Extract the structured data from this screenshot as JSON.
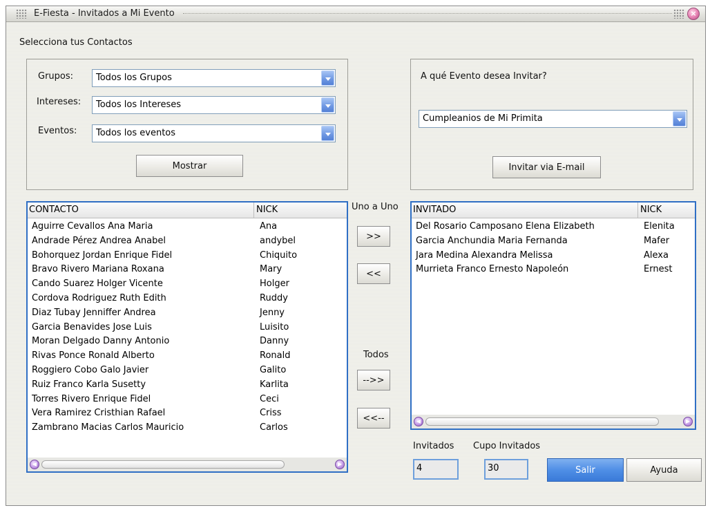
{
  "window": {
    "title": "E-Fiesta  - Invitados a Mi Evento",
    "close_glyph": "×"
  },
  "section_title": "Selecciona tus Contactos",
  "filters": {
    "grupos_label": "Grupos:",
    "grupos_value": "Todos los Grupos",
    "intereses_label": "Intereses:",
    "intereses_value": "Todos los Intereses",
    "eventos_label": "Eventos:",
    "eventos_value": "Todos los eventos",
    "mostrar_label": "Mostrar"
  },
  "event": {
    "question": "A qué Evento desea Invitar?",
    "selected_event": "Cumpleanios de Mi Primita",
    "invite_button": "Invitar via E-mail"
  },
  "contacts": {
    "columns": [
      "CONTACTO",
      "NICK"
    ],
    "rows": [
      [
        "Aguirre Cevallos Ana Maria",
        "Ana"
      ],
      [
        "Andrade Pérez Andrea Anabel",
        "andybel"
      ],
      [
        "Bohorquez Jordan Enrique Fidel",
        "Chiquito"
      ],
      [
        "Bravo Rivero Mariana Roxana",
        "Mary"
      ],
      [
        "Cando Suarez Holger Vicente",
        "Holger"
      ],
      [
        "Cordova Rodriguez Ruth Edith",
        "Ruddy"
      ],
      [
        "Diaz Tubay Jenniffer Andrea",
        "Jenny"
      ],
      [
        "Garcia Benavides Jose Luis",
        "Luisito"
      ],
      [
        "Moran Delgado Danny Antonio",
        "Danny"
      ],
      [
        "Rivas Ponce Ronald Alberto",
        "Ronald"
      ],
      [
        "Roggiero Cobo Galo Javier",
        "Galito"
      ],
      [
        "Ruiz Franco Karla Susetty",
        "Karlita"
      ],
      [
        "Torres Rivero Enrique Fidel",
        "Ceci"
      ],
      [
        "Vera Ramirez Cristhian Rafael",
        "Criss"
      ],
      [
        "Zambrano Macias Carlos Mauricio",
        "Carlos"
      ]
    ]
  },
  "transfer": {
    "uno_label": "Uno a Uno",
    "add_one": ">>",
    "remove_one": "<<",
    "todos_label": "Todos",
    "add_all": "-->>",
    "remove_all": "<<--"
  },
  "invited": {
    "columns": [
      "INVITADO",
      "NICK"
    ],
    "rows": [
      [
        "Del Rosario Camposano Elena Elizabeth",
        "Elenita"
      ],
      [
        "Garcia Anchundia Maria Fernanda",
        "Mafer"
      ],
      [
        "Jara Medina Alexandra Melissa",
        "Alexa"
      ],
      [
        "Murrieta Franco  Ernesto Napoleón",
        "Ernest"
      ]
    ]
  },
  "footer": {
    "invitados_label": "Invitados",
    "invitados_value": "4",
    "cupo_label": "Cupo Invitados",
    "cupo_value": "30",
    "salir_label": "Salir",
    "ayuda_label": "Ayuda"
  },
  "scroll_glyphs": {
    "left": "◀",
    "right": "▶"
  },
  "colors": {
    "accent": "#2f6fc5",
    "salir_button": "#4f8fe6",
    "window_bg": "#efefea"
  }
}
